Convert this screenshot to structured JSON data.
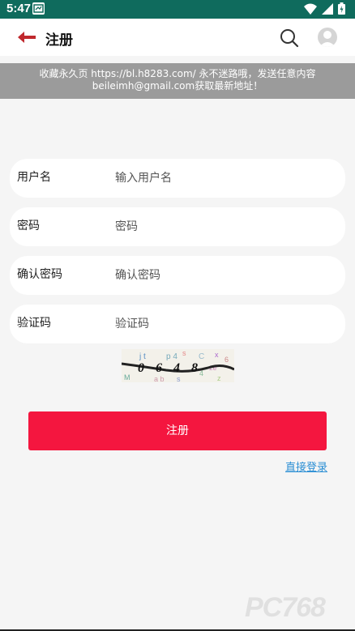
{
  "status_bar": {
    "time": "5:47"
  },
  "app_bar": {
    "title": "注册"
  },
  "banner": {
    "line1": "收藏永久页 https://bl.h8283.com/ 永不迷路哦，发送任意内容",
    "line2": "beileimh@gmail.com获取最新地址！"
  },
  "form": {
    "fields": [
      {
        "label": "用户名",
        "placeholder": "输入用户名"
      },
      {
        "label": "密码",
        "placeholder": "密码"
      },
      {
        "label": "确认密码",
        "placeholder": "确认密码"
      },
      {
        "label": "验证码",
        "placeholder": "验证码"
      }
    ],
    "captcha_text": "0648",
    "submit_label": "注册",
    "login_link": "直接登录"
  },
  "watermark": "PC768",
  "colors": {
    "status_bar": "#0f6b5d",
    "accent": "#f4163f",
    "link": "#2a8ed4",
    "banner": "#9b9b9b",
    "back_arrow": "#c0282d"
  },
  "icons": [
    "wifi-icon",
    "signal-icon",
    "battery-icon",
    "back-arrow-icon",
    "search-icon",
    "avatar-icon"
  ]
}
